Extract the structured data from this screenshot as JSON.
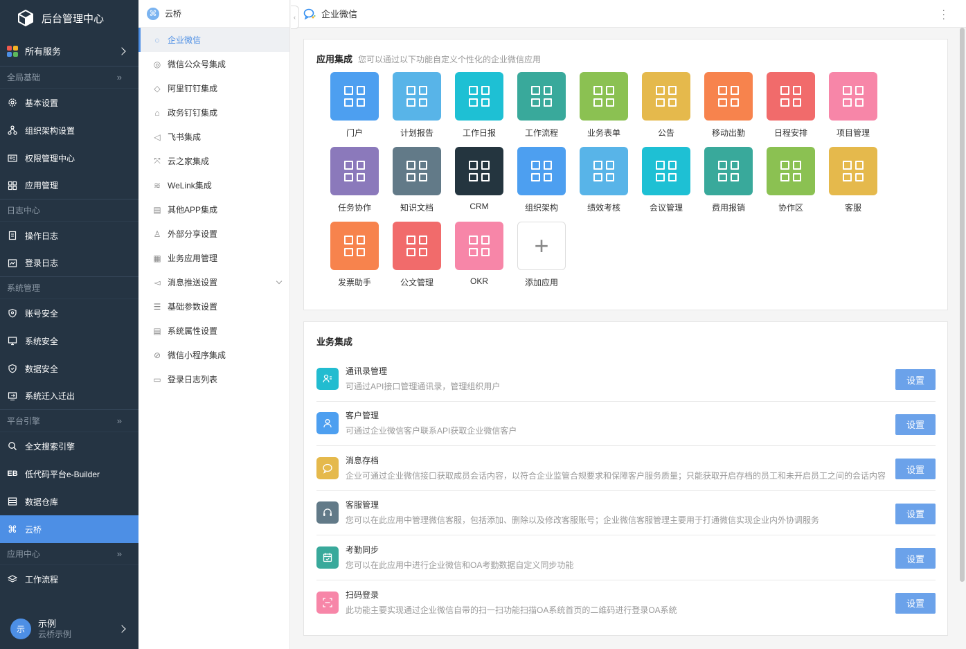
{
  "brand": {
    "title": "后台管理中心"
  },
  "all_services": "所有服务",
  "sidebar": {
    "sections": [
      {
        "label": "全局基础",
        "items": [
          "基本设置",
          "组织架构设置",
          "权限管理中心",
          "应用管理"
        ]
      },
      {
        "label": "日志中心",
        "items": [
          "操作日志",
          "登录日志"
        ]
      },
      {
        "label": "系统管理",
        "items": [
          "账号安全",
          "系统安全",
          "数据安全",
          "系统迁入迁出"
        ]
      },
      {
        "label": "平台引擎",
        "items": [
          "全文搜索引擎",
          "低代码平台e-Builder",
          "数据仓库",
          "云桥"
        ]
      },
      {
        "label": "应用中心",
        "items": [
          "工作流程"
        ]
      }
    ],
    "eb_icon_text": "EB",
    "active": "云桥"
  },
  "user": {
    "avatar": "示",
    "name": "示例",
    "sub": "云桥示例"
  },
  "submenu": {
    "title": "云桥",
    "items": [
      "企业微信",
      "微信公众号集成",
      "阿里钉钉集成",
      "政务钉钉集成",
      "飞书集成",
      "云之家集成",
      "WeLink集成",
      "其他APP集成",
      "外部分享设置",
      "业务应用管理",
      "消息推送设置",
      "基础参数设置",
      "系统属性设置",
      "微信小程序集成",
      "登录日志列表"
    ],
    "active": "企业微信"
  },
  "topbar": {
    "title": "企业微信"
  },
  "app_section": {
    "title": "应用集成",
    "desc": "您可以通过以下功能自定义个性化的企业微信应用",
    "apps": [
      {
        "label": "门户",
        "color": "#4d9ff0"
      },
      {
        "label": "计划报告",
        "color": "#58b4e8"
      },
      {
        "label": "工作日报",
        "color": "#1ec0d4"
      },
      {
        "label": "工作流程",
        "color": "#39a99b"
      },
      {
        "label": "业务表单",
        "color": "#8bc152"
      },
      {
        "label": "公告",
        "color": "#e5b94c"
      },
      {
        "label": "移动出勤",
        "color": "#f7834d"
      },
      {
        "label": "日程安排",
        "color": "#f16b6b"
      },
      {
        "label": "项目管理",
        "color": "#f786a8"
      },
      {
        "label": "任务协作",
        "color": "#8b79bb"
      },
      {
        "label": "知识文档",
        "color": "#627a88"
      },
      {
        "label": "CRM",
        "color": "#24353f"
      },
      {
        "label": "组织架构",
        "color": "#4d9ff0"
      },
      {
        "label": "绩效考核",
        "color": "#58b4e8"
      },
      {
        "label": "会议管理",
        "color": "#1ec0d4"
      },
      {
        "label": "费用报销",
        "color": "#39a99b"
      },
      {
        "label": "协作区",
        "color": "#8bc152"
      },
      {
        "label": "客服",
        "color": "#e5b94c"
      },
      {
        "label": "发票助手",
        "color": "#f7834d"
      },
      {
        "label": "公文管理",
        "color": "#f16b6b"
      },
      {
        "label": "OKR",
        "color": "#f786a8"
      }
    ],
    "add_label": "添加应用"
  },
  "biz_section": {
    "title": "业务集成",
    "button_label": "设置",
    "rows": [
      {
        "title": "通讯录管理",
        "desc": "可通过API接口管理通讯录，管理组织用户",
        "color": "#22bcd0",
        "icon": "contacts-icon"
      },
      {
        "title": "客户管理",
        "desc": "可通过企业微信客户联系API获取企业微信客户",
        "color": "#4d9ff0",
        "icon": "customer-icon"
      },
      {
        "title": "消息存档",
        "desc": "企业可通过企业微信接口获取成员会话内容，以符合企业监管合规要求和保障客户服务质量；只能获取开启存档的员工和未开启员工之间的会话内容",
        "color": "#e5b94c",
        "icon": "message-icon"
      },
      {
        "title": "客服管理",
        "desc": "您可以在此应用中管理微信客服，包括添加、删除以及修改客服账号；企业微信客服管理主要用于打通微信实现企业内外协调服务",
        "color": "#627a88",
        "icon": "headset-icon"
      },
      {
        "title": "考勤同步",
        "desc": "您可以在此应用中进行企业微信和OA考勤数据自定义同步功能",
        "color": "#39a99b",
        "icon": "calendar-icon"
      },
      {
        "title": "扫码登录",
        "desc": "此功能主要实现通过企业微信自带的扫一扫功能扫描OA系统首页的二维码进行登录OA系统",
        "color": "#f786a8",
        "icon": "scan-icon"
      }
    ]
  },
  "colors": {
    "accent": "#4d8fe5",
    "sidebar_bg": "#253443"
  }
}
